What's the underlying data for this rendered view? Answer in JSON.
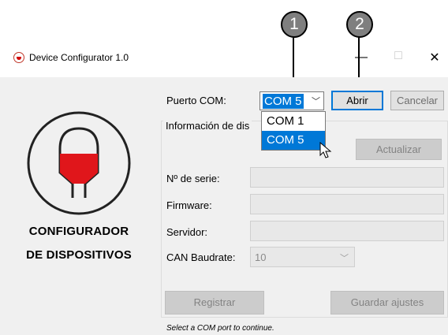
{
  "callouts": [
    "1",
    "2"
  ],
  "window": {
    "title": "Device Configurator 1.0",
    "minimize_glyph": "—",
    "maximize_glyph": "□",
    "close_glyph": "✕"
  },
  "logo": {
    "line1": "CONFIGURADOR",
    "line2": "DE DISPOSITIVOS",
    "colors": {
      "fill": "#e0161b",
      "stroke": "#222222"
    }
  },
  "com": {
    "label": "Puerto COM:",
    "selected": "COM 5",
    "options": [
      "COM 1",
      "COM 5"
    ],
    "highlighted_option": "COM 5",
    "open_button": "Abrir",
    "cancel_button": "Cancelar"
  },
  "info": {
    "group_title": "Información de dis",
    "refresh_button": "Actualizar",
    "serial_label": "Nº de serie:",
    "firmware_label": "Firmware:",
    "server_label": "Servidor:",
    "baud_label": "CAN Baudrate:",
    "baud_value": "10"
  },
  "actions": {
    "register_button": "Registrar",
    "save_button": "Guardar ajustes"
  },
  "status_text": "Select a COM port to continue.",
  "colors": {
    "accent": "#0078d7",
    "client_bg": "#f0f0f0"
  }
}
